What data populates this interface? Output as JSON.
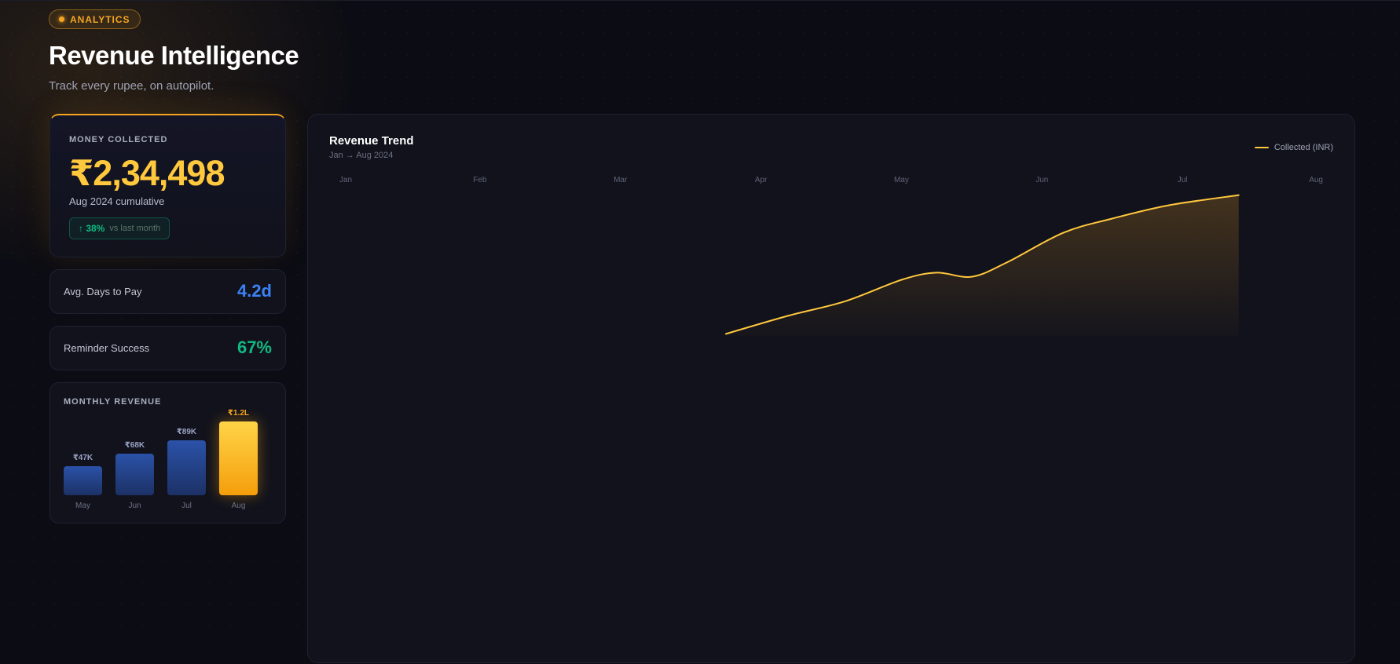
{
  "header": {
    "badge": "ANALYTICS",
    "title": "Revenue Intelligence",
    "subtitle": "Track every rupee, on autopilot."
  },
  "money_collected": {
    "label": "MONEY COLLECTED",
    "value": "₹2,34,498",
    "period": "Aug 2024 cumulative",
    "delta": "↑ 38%",
    "delta_note": "vs last month"
  },
  "stats": [
    {
      "label": "Avg. Days to Pay",
      "value": "4.2d",
      "color": "#3b82f6"
    },
    {
      "label": "Reminder Success",
      "value": "67%",
      "color": "#10b981"
    }
  ],
  "monthly_revenue": {
    "label": "MONTHLY REVENUE",
    "bars": [
      {
        "month": "May",
        "label": "₹47K",
        "value": 47000
      },
      {
        "month": "Jun",
        "label": "₹68K",
        "value": 68000
      },
      {
        "month": "Jul",
        "label": "₹89K",
        "value": 89000
      },
      {
        "month": "Aug",
        "label": "₹1.2L",
        "value": 120000,
        "highlight": true
      }
    ]
  },
  "colors": {
    "accent": "#ffc83d",
    "orange": "#f5a623",
    "blue": "#3b82f6",
    "green": "#10b981",
    "background": "#0b0c14",
    "card": "#11121c"
  },
  "chart_data": {
    "type": "area",
    "title": "Revenue Trend",
    "subtitle": "Jan → Aug 2024",
    "legend": "Collected (INR)",
    "legend_position": "top-right",
    "categories": [
      "Jan",
      "Feb",
      "Mar",
      "Apr",
      "May",
      "Jun",
      "Jul",
      "Aug"
    ],
    "x": [
      2.75,
      3.2,
      3.6,
      4.0,
      4.25,
      4.5,
      4.75,
      5.15,
      5.5,
      5.9,
      6.4
    ],
    "series": [
      {
        "name": "Collected (INR)",
        "values": [
          2,
          20,
          34,
          55,
          62,
          58,
          72,
          101,
          115,
          128,
          138
        ]
      }
    ],
    "grid": false
  }
}
